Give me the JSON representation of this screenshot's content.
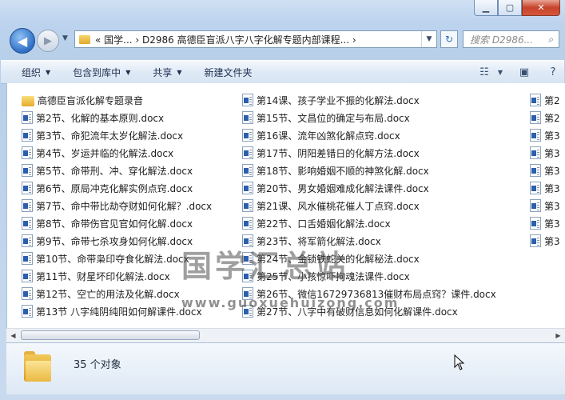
{
  "address": {
    "path": "«  国学...  ›  D2986 高德臣盲派八字八字化解专题内部课程...  ›"
  },
  "search": {
    "placeholder": "搜索 D2986..."
  },
  "toolbar": {
    "organize": "组织",
    "include": "包含到库中",
    "share": "共享",
    "new_folder": "新建文件夹"
  },
  "columns": [
    [
      {
        "type": "folder",
        "name": "高德臣盲派化解专题录音"
      },
      {
        "type": "doc",
        "name": "第2节、化解的基本原则.docx"
      },
      {
        "type": "doc",
        "name": "第3节、命犯流年太岁化解法.docx"
      },
      {
        "type": "doc",
        "name": "第4节、岁运并临的化解法.docx"
      },
      {
        "type": "doc",
        "name": "第5节、命带刑、冲、穿化解法.docx"
      },
      {
        "type": "doc",
        "name": "第6节、原局冲克化解实例点窍.docx"
      },
      {
        "type": "doc",
        "name": "第7节、命中带比劫夺财如何化解？.docx"
      },
      {
        "type": "doc",
        "name": "第8节、命带伤官见官如何化解.docx"
      },
      {
        "type": "doc",
        "name": "第9节、命带七杀攻身如何化解.docx"
      },
      {
        "type": "doc",
        "name": "第10节、命带枭印夺食化解法.docx"
      },
      {
        "type": "doc",
        "name": "第11节、财星坏印化解法.docx"
      },
      {
        "type": "doc",
        "name": "第12节、空亡的用法及化解.docx"
      },
      {
        "type": "doc",
        "name": "第13节 八字纯阴纯阳如何解课件.docx"
      }
    ],
    [
      {
        "type": "doc",
        "name": "第14课、孩子学业不振的化解法.docx"
      },
      {
        "type": "doc",
        "name": "第15节、文昌位的确定与布局.docx"
      },
      {
        "type": "doc",
        "name": "第16课、流年凶煞化解点窍.docx"
      },
      {
        "type": "doc",
        "name": "第17节、阴阳差错日的化解方法.docx"
      },
      {
        "type": "doc",
        "name": "第18节、影响婚姻不顺的神煞化解.docx"
      },
      {
        "type": "doc",
        "name": "第20节、男女婚姻难成化解法课件.docx"
      },
      {
        "type": "doc",
        "name": "第21课、风水催桃花催人丁点窍.docx"
      },
      {
        "type": "doc",
        "name": "第22节、口舌婚姻化解法.docx"
      },
      {
        "type": "doc",
        "name": "第23节、将军箭化解法.docx"
      },
      {
        "type": "doc",
        "name": "第24节、金锁铁蛇关的化解秘法.docx"
      },
      {
        "type": "doc",
        "name": "第25节、小孩惊吓拘魂法课件.docx"
      },
      {
        "type": "doc",
        "name": "第26节、微信16729736813催财布局点窍？课件.docx"
      },
      {
        "type": "doc",
        "name": "第27节、八字中有破财信息如何化解课件.docx"
      }
    ],
    [
      {
        "type": "doc",
        "name": "第2"
      },
      {
        "type": "doc",
        "name": "第2"
      },
      {
        "type": "doc",
        "name": "第3"
      },
      {
        "type": "doc",
        "name": "第3"
      },
      {
        "type": "doc",
        "name": "第3"
      },
      {
        "type": "doc",
        "name": "第3"
      },
      {
        "type": "doc",
        "name": "第3"
      },
      {
        "type": "doc",
        "name": "第3"
      },
      {
        "type": "doc",
        "name": "第3"
      }
    ]
  ],
  "status": {
    "count": "35 个对象"
  },
  "watermark": {
    "title": "国学汇总站",
    "url": "www.guoxuehuizong.com"
  }
}
